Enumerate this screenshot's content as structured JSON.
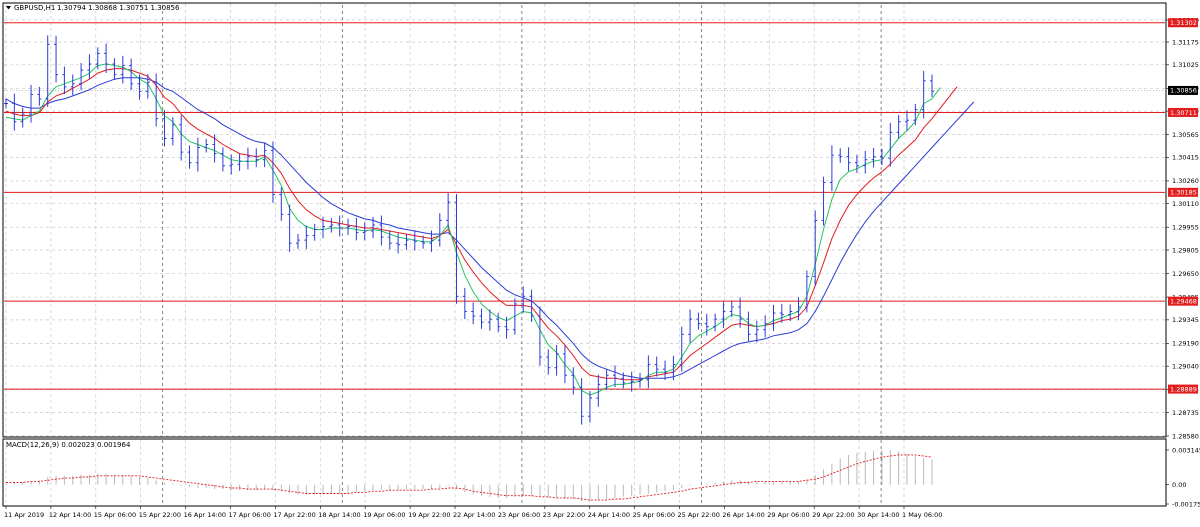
{
  "header": {
    "symbol_title": "GBPUSD,H1",
    "quotes": "1.30794 1.30868 1.30751 1.30856"
  },
  "indicator": {
    "title": "MACD(12,26,9) 0.002023 0.001964"
  },
  "colors": {
    "candles": "#2a3bd6",
    "ma_fast": "#22c55e",
    "ma_mid": "#e11d1d",
    "ma_slow": "#2a3bd6",
    "levels": "#e11d1d",
    "grid": "#c8c8c8",
    "macd_hist": "#b9b9b9",
    "macd_signal": "#e11d1d",
    "current_price_bg": "#000000"
  },
  "chart_data": [
    {
      "type": "candlestick",
      "title": "GBPUSD,H1",
      "x_tick_labels": [
        "11 Apr 2019",
        "12 Apr 14:00",
        "15 Apr 06:00",
        "15 Apr 22:00",
        "16 Apr 14:00",
        "17 Apr 06:00",
        "17 Apr 22:00",
        "18 Apr 14:00",
        "19 Apr 06:00",
        "19 Apr 22:00",
        "22 Apr 14:00",
        "23 Apr 06:00",
        "23 Apr 22:00",
        "24 Apr 14:00",
        "25 Apr 06:00",
        "25 Apr 22:00",
        "26 Apr 14:00",
        "29 Apr 06:00",
        "29 Apr 22:00",
        "30 Apr 14:00",
        "1 May 06:00"
      ],
      "y_tick_labels": [
        "1.31320",
        "1.31175",
        "1.31025",
        "1.30870",
        "1.30720",
        "1.30565",
        "1.30415",
        "1.30260",
        "1.30110",
        "1.29955",
        "1.29805",
        "1.29650",
        "1.29495",
        "1.29345",
        "1.29190",
        "1.29040",
        "1.28885",
        "1.28735",
        "1.28580"
      ],
      "ylim": [
        1.2858,
        1.3132
      ],
      "grid": true,
      "series": [
        {
          "name": "close",
          "values": [
            1.3077,
            1.3065,
            1.307,
            1.3083,
            1.308,
            1.3116,
            1.3096,
            1.3088,
            1.309,
            1.3099,
            1.3103,
            1.311,
            1.3103,
            1.3096,
            1.3102,
            1.309,
            1.3085,
            1.3091,
            1.3067,
            1.3054,
            1.3063,
            1.3045,
            1.3038,
            1.3048,
            1.305,
            1.3044,
            1.3036,
            1.3037,
            1.3039,
            1.3042,
            1.304,
            1.3046,
            1.3017,
            1.3004,
            1.2985,
            1.2987,
            1.299,
            1.2994,
            1.2996,
            1.2997,
            1.2995,
            1.2996,
            1.2992,
            1.2993,
            1.2997,
            1.2989,
            1.2985,
            1.2984,
            1.2987,
            1.2986,
            1.2985,
            1.2987,
            1.3,
            1.3012,
            1.295,
            1.294,
            1.2937,
            1.2933,
            1.2935,
            1.293,
            1.2928,
            1.2945,
            1.295,
            1.2937,
            1.291,
            1.2903,
            1.2912,
            1.2898,
            1.289,
            1.2871,
            1.2883,
            1.2892,
            1.2898,
            1.2896,
            1.2893,
            1.2894,
            1.2895,
            1.2905,
            1.2902,
            1.29,
            1.2905,
            1.2925,
            1.2935,
            1.2932,
            1.293,
            1.2935,
            1.294,
            1.2943,
            1.2935,
            1.2925,
            1.2928,
            1.2932,
            1.2939,
            1.2938,
            1.294,
            1.2943,
            1.2963,
            1.3,
            1.3025,
            1.3043,
            1.3042,
            1.3038,
            1.3036,
            1.304,
            1.3042,
            1.3041,
            1.3058,
            1.3065,
            1.3066,
            1.3073,
            1.3092,
            1.3085
          ]
        },
        {
          "name": "ma_fast",
          "values": [
            1.3068,
            1.3067,
            1.3066,
            1.3069,
            1.3072,
            1.3082,
            1.3088,
            1.309,
            1.3092,
            1.3094,
            1.3097,
            1.3102,
            1.3103,
            1.3102,
            1.3101,
            1.3098,
            1.3093,
            1.309,
            1.308,
            1.3069,
            1.3065,
            1.3057,
            1.3052,
            1.305,
            1.3048,
            1.3046,
            1.3043,
            1.304,
            1.3039,
            1.3039,
            1.3039,
            1.3042,
            1.3033,
            1.3023,
            1.3008,
            1.3,
            1.2996,
            1.2994,
            1.2994,
            1.2995,
            1.2995,
            1.2995,
            1.2994,
            1.2993,
            1.2994,
            1.2993,
            1.2991,
            1.2989,
            1.2988,
            1.2987,
            1.2986,
            1.2986,
            1.299,
            1.2997,
            1.2979,
            1.2964,
            1.2953,
            1.2945,
            1.294,
            1.2936,
            1.2934,
            1.2937,
            1.294,
            1.2939,
            1.2928,
            1.2918,
            1.2913,
            1.2905,
            1.2899,
            1.2888,
            1.2885,
            1.2887,
            1.289,
            1.2892,
            1.2892,
            1.2893,
            1.2894,
            1.2898,
            1.29,
            1.29,
            1.2902,
            1.291,
            1.2919,
            1.2924,
            1.2927,
            1.293,
            1.2934,
            1.2938,
            1.2937,
            1.2932,
            1.293,
            1.2931,
            1.2934,
            1.2936,
            1.2938,
            1.294,
            1.295,
            1.2971,
            1.2994,
            1.3014,
            1.3027,
            1.3032,
            1.3034,
            1.3037,
            1.3039,
            1.304,
            1.3047,
            1.3054,
            1.3059,
            1.3065,
            1.3077,
            1.308
          ]
        },
        {
          "name": "ma_mid",
          "values": [
            1.3072,
            1.307,
            1.3069,
            1.3069,
            1.3071,
            1.3078,
            1.3082,
            1.3084,
            1.3087,
            1.309,
            1.3093,
            1.3097,
            1.3099,
            1.31,
            1.31,
            1.3099,
            1.3097,
            1.3095,
            1.3089,
            1.3081,
            1.3077,
            1.307,
            1.3064,
            1.306,
            1.3057,
            1.3054,
            1.305,
            1.3047,
            1.3044,
            1.3043,
            1.3042,
            1.3043,
            1.3038,
            1.3031,
            1.3021,
            1.3013,
            1.3007,
            1.3003,
            1.3,
            1.2999,
            1.2998,
            1.2997,
            1.2996,
            1.2995,
            1.2995,
            1.2994,
            1.2993,
            1.2992,
            1.2991,
            1.299,
            1.2989,
            1.2988,
            1.299,
            1.2994,
            1.2984,
            1.2974,
            1.2966,
            1.2959,
            1.2953,
            1.2948,
            1.2944,
            1.2944,
            1.2944,
            1.2943,
            1.2936,
            1.2929,
            1.2924,
            1.2918,
            1.2911,
            1.2903,
            1.2898,
            1.2897,
            1.2896,
            1.2896,
            1.2895,
            1.2895,
            1.2895,
            1.2897,
            1.2898,
            1.2899,
            1.29,
            1.2905,
            1.2911,
            1.2915,
            1.2919,
            1.2923,
            1.2927,
            1.2931,
            1.2932,
            1.2931,
            1.293,
            1.2931,
            1.2932,
            1.2934,
            1.2935,
            1.2937,
            1.2943,
            1.2957,
            1.2972,
            1.2988,
            1.3,
            1.301,
            1.3017,
            1.3023,
            1.3028,
            1.3032,
            1.3037,
            1.3043,
            1.3048,
            1.3053,
            1.3061,
            1.3067
          ]
        },
        {
          "name": "ma_slow",
          "values": [
            1.308,
            1.3077,
            1.3075,
            1.3074,
            1.3074,
            1.3077,
            1.3079,
            1.308,
            1.3082,
            1.3084,
            1.3086,
            1.3089,
            1.3091,
            1.3093,
            1.3094,
            1.3094,
            1.3094,
            1.3093,
            1.3091,
            1.3087,
            1.3085,
            1.3081,
            1.3077,
            1.3073,
            1.307,
            1.3067,
            1.3063,
            1.306,
            1.3057,
            1.3054,
            1.3052,
            1.3051,
            1.3048,
            1.3043,
            1.3037,
            1.3031,
            1.3025,
            1.302,
            1.3015,
            1.3011,
            1.3008,
            1.3005,
            1.3003,
            1.3001,
            1.3,
            1.2998,
            1.2997,
            1.2995,
            1.2994,
            1.2993,
            1.2992,
            1.2991,
            1.2991,
            1.2992,
            1.2987,
            1.2981,
            1.2975,
            1.2969,
            1.2964,
            1.2959,
            1.2954,
            1.2951,
            1.2949,
            1.2947,
            1.2942,
            1.2936,
            1.2931,
            1.2925,
            1.2919,
            1.2912,
            1.2907,
            1.2904,
            1.2902,
            1.29,
            1.2898,
            1.2897,
            1.2896,
            1.2896,
            1.2896,
            1.2896,
            1.2897,
            1.2899,
            1.2902,
            1.2905,
            1.2908,
            1.2911,
            1.2914,
            1.2917,
            1.2919,
            1.292,
            1.2921,
            1.2922,
            1.2924,
            1.2925,
            1.2926,
            1.2928,
            1.2932,
            1.294,
            1.295,
            1.2961,
            1.2972,
            1.2982,
            1.2991,
            1.2999,
            1.3006,
            1.3012,
            1.3018,
            1.3024,
            1.303,
            1.3036,
            1.3042,
            1.3048
          ]
        }
      ],
      "levels": [
        1.31302,
        1.30711,
        1.30185,
        1.29468,
        1.28889
      ],
      "level_labels": [
        "1.31302",
        "1.30711",
        "1.30185",
        "1.29468",
        "1.28889"
      ],
      "current_price": 1.30856,
      "current_price_label": "1.30856"
    },
    {
      "type": "bar",
      "title": "MACD(12,26,9) 0.002023 0.001964",
      "y_tick_labels": [
        "0.003145",
        "0.00",
        "-0.001754"
      ],
      "ylim": [
        -0.001754,
        0.003145
      ],
      "series": [
        {
          "name": "MACD",
          "values": [
            0.0003,
            0.0002,
            0.0002,
            0.0003,
            0.0004,
            0.0007,
            0.0008,
            0.0008,
            0.0008,
            0.0009,
            0.0009,
            0.001,
            0.001,
            0.0009,
            0.0009,
            0.0008,
            0.0007,
            0.0006,
            0.0004,
            0.0002,
            0.0001,
            -0.0001,
            -0.0002,
            -0.0003,
            -0.0003,
            -0.0004,
            -0.0004,
            -0.0005,
            -0.0005,
            -0.0005,
            -0.0005,
            -0.0004,
            -0.0005,
            -0.0006,
            -0.0008,
            -0.0009,
            -0.0009,
            -0.0009,
            -0.0009,
            -0.0008,
            -0.0008,
            -0.0007,
            -0.0006,
            -0.0006,
            -0.0005,
            -0.0005,
            -0.0005,
            -0.0005,
            -0.0004,
            -0.0004,
            -0.0004,
            -0.0004,
            -0.0003,
            -0.0001,
            -0.0004,
            -0.0007,
            -0.0009,
            -0.001,
            -0.0011,
            -0.0012,
            -0.0012,
            -0.0011,
            -0.001,
            -0.001,
            -0.0011,
            -0.0012,
            -0.0012,
            -0.0013,
            -0.0013,
            -0.0015,
            -0.0015,
            -0.0014,
            -0.0013,
            -0.0012,
            -0.0011,
            -0.001,
            -0.0009,
            -0.0008,
            -0.0007,
            -0.0006,
            -0.0005,
            -0.0003,
            -0.0001,
            0.0,
            0.0001,
            0.0002,
            0.0003,
            0.0004,
            0.0004,
            0.0003,
            0.0003,
            0.0003,
            0.0003,
            0.0003,
            0.0003,
            0.0003,
            0.0005,
            0.0009,
            0.0014,
            0.0019,
            0.0024,
            0.0027,
            0.0029,
            0.003,
            0.0031,
            0.0031,
            0.0031,
            0.003,
            0.0028,
            0.0026,
            0.0024,
            0.0023
          ]
        },
        {
          "name": "Signal",
          "values": [
            0.0002,
            0.0002,
            0.0002,
            0.0003,
            0.0003,
            0.0004,
            0.0005,
            0.0006,
            0.0006,
            0.0007,
            0.0007,
            0.0008,
            0.0008,
            0.0008,
            0.0008,
            0.0008,
            0.0008,
            0.0007,
            0.0006,
            0.0005,
            0.0004,
            0.0003,
            0.0002,
            0.0001,
            0.0,
            -0.0001,
            -0.0002,
            -0.0003,
            -0.0003,
            -0.0004,
            -0.0004,
            -0.0004,
            -0.0004,
            -0.0005,
            -0.0006,
            -0.0007,
            -0.0008,
            -0.0008,
            -0.0008,
            -0.0008,
            -0.0008,
            -0.0008,
            -0.0007,
            -0.0007,
            -0.0006,
            -0.0006,
            -0.0005,
            -0.0005,
            -0.0005,
            -0.0005,
            -0.0005,
            -0.0004,
            -0.0004,
            -0.0003,
            -0.0003,
            -0.0004,
            -0.0006,
            -0.0007,
            -0.0008,
            -0.0009,
            -0.001,
            -0.001,
            -0.001,
            -0.001,
            -0.0011,
            -0.0011,
            -0.0012,
            -0.0012,
            -0.0012,
            -0.0013,
            -0.0014,
            -0.0014,
            -0.0014,
            -0.0013,
            -0.0013,
            -0.0012,
            -0.0011,
            -0.001,
            -0.0009,
            -0.0008,
            -0.0007,
            -0.0006,
            -0.0004,
            -0.0003,
            -0.0002,
            -0.0001,
            0.0,
            0.0001,
            0.0002,
            0.0002,
            0.0003,
            0.0003,
            0.0003,
            0.0003,
            0.0003,
            0.0003,
            0.0004,
            0.0005,
            0.0007,
            0.001,
            0.0013,
            0.0016,
            0.0019,
            0.0021,
            0.0023,
            0.0025,
            0.0026,
            0.0027,
            0.0027,
            0.0027,
            0.0026,
            0.0025
          ]
        }
      ]
    }
  ]
}
